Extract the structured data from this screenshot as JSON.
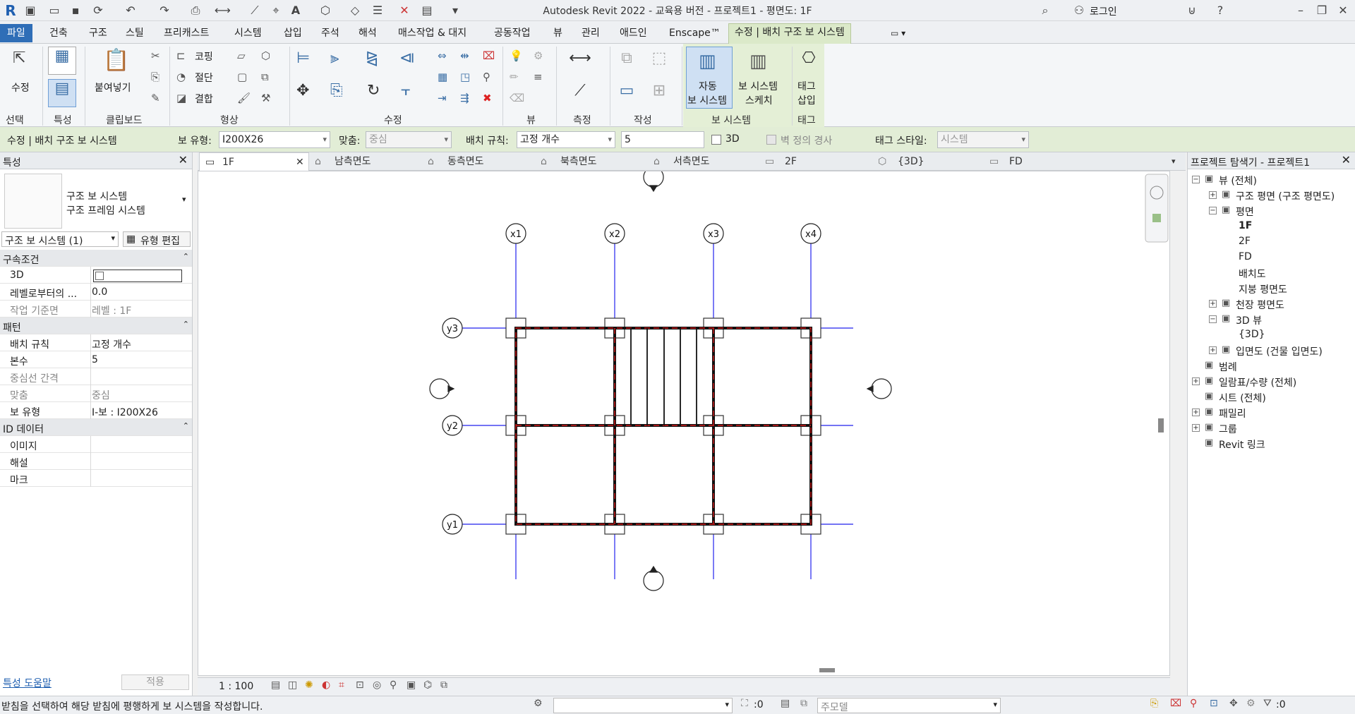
{
  "app": {
    "title": "Autodesk Revit 2022 - 교육용 버전 - 프로젝트1 - 평면도: 1F",
    "login": "로그인"
  },
  "menu": {
    "tabs": [
      "파일",
      "건축",
      "구조",
      "스틸",
      "프리캐스트",
      "시스템",
      "삽입",
      "주석",
      "해석",
      "매스작업 & 대지",
      "공동작업",
      "뷰",
      "관리",
      "애드인",
      "Enscape™"
    ],
    "context_tab": "수정 | 배치 구조 보 시스템"
  },
  "ribbon": {
    "modify_label": "수정",
    "select_label": "선택",
    "properties_label": "특성",
    "paste_label": "붙여넣기",
    "clipboard_label": "클립보드",
    "cope_label": "코핑",
    "cut_label": "절단",
    "join_label": "결합",
    "geometry_label": "형상",
    "modify_panel_label": "수정",
    "view_panel_label": "뷰",
    "measure_panel_label": "측정",
    "create_panel_label": "작성",
    "auto_beam_label_1": "자동",
    "auto_beam_label_2": "보 시스템",
    "sketch_label_1": "보 시스템",
    "sketch_label_2": "스케치",
    "tag_label_1": "태그",
    "tag_label_2": "삽입",
    "beam_system_panel": "보 시스템",
    "tag_panel": "태그"
  },
  "options": {
    "context": "수정 | 배치 구조 보 시스템",
    "beam_type_label": "보 유형:",
    "beam_type_value": "I200X26",
    "justify_label": "맞춤:",
    "justify_value": "중심",
    "layout_label": "배치 규칙:",
    "layout_value": "고정 개수",
    "count_value": "5",
    "three_d_label": "3D",
    "wall_slope_label": "벽 정의 경사",
    "tag_style_label": "태그 스타일:",
    "tag_style_value": "시스템"
  },
  "properties": {
    "header": "특성",
    "type_line1": "구조 보 시스템",
    "type_line2": "구조 프레임 시스템",
    "selector": "구조 보 시스템 (1)",
    "edit_type": "유형 편집",
    "sections": [
      {
        "title": "구속조건",
        "rows": [
          {
            "k": "3D",
            "v": "",
            "checkbox": true
          },
          {
            "k": "레벨로부터의 ...",
            "v": "0.0"
          },
          {
            "k": "작업 기준면",
            "v": "레벨 : 1F",
            "grey": true
          }
        ]
      },
      {
        "title": "패턴",
        "rows": [
          {
            "k": "배치 규칙",
            "v": "고정 개수"
          },
          {
            "k": "본수",
            "v": "5"
          },
          {
            "k": "중심선 간격",
            "v": "",
            "grey": true
          },
          {
            "k": "맞춤",
            "v": "중심",
            "grey": true
          },
          {
            "k": "보 유형",
            "v": "I-보 : I200X26"
          }
        ]
      },
      {
        "title": "ID 데이터",
        "rows": [
          {
            "k": "이미지",
            "v": ""
          },
          {
            "k": "해설",
            "v": ""
          },
          {
            "k": "마크",
            "v": ""
          }
        ]
      }
    ],
    "help_link": "특성 도움말",
    "apply": "적용"
  },
  "view_tabs": [
    {
      "label": "1F",
      "active": true
    },
    {
      "label": "남측면도"
    },
    {
      "label": "동측면도"
    },
    {
      "label": "북측면도"
    },
    {
      "label": "서측면도"
    },
    {
      "label": "2F"
    },
    {
      "label": "{3D}"
    },
    {
      "label": "FD"
    }
  ],
  "grid": {
    "x_labels": [
      "x1",
      "x2",
      "x3",
      "x4"
    ],
    "y_labels": [
      "y3",
      "y2",
      "y1"
    ]
  },
  "view_bar": {
    "scale": "1 : 100"
  },
  "browser": {
    "header": "프로젝트 탐색기 - 프로젝트1",
    "nodes": [
      {
        "label": "뷰 (전체)",
        "level": 0,
        "tog": "−"
      },
      {
        "label": "구조 평면 (구조 평면도)",
        "level": 1,
        "tog": "+"
      },
      {
        "label": "평면",
        "level": 1,
        "tog": "−"
      },
      {
        "label": "1F",
        "level": 2,
        "bold": true
      },
      {
        "label": "2F",
        "level": 2
      },
      {
        "label": "FD",
        "level": 2
      },
      {
        "label": "배치도",
        "level": 2
      },
      {
        "label": "지붕 평면도",
        "level": 2
      },
      {
        "label": "천장 평면도",
        "level": 1,
        "tog": "+"
      },
      {
        "label": "3D 뷰",
        "level": 1,
        "tog": "−"
      },
      {
        "label": "{3D}",
        "level": 2
      },
      {
        "label": "입면도 (건물 입면도)",
        "level": 1,
        "tog": "+"
      },
      {
        "label": "범례",
        "level": 0
      },
      {
        "label": "일람표/수량 (전체)",
        "level": 0,
        "tog": "+"
      },
      {
        "label": "시트 (전체)",
        "level": 0
      },
      {
        "label": "패밀리",
        "level": 0,
        "tog": "+"
      },
      {
        "label": "그룹",
        "level": 0,
        "tog": "+"
      },
      {
        "label": "Revit 링크",
        "level": 0
      }
    ]
  },
  "status": {
    "message": "받침을 선택하여 해당 받침에 평행하게 보 시스템을 작성합니다.",
    "worksets": ":0",
    "model": "주모델",
    "filter": ":0"
  },
  "colors": {
    "accent": "#2f6eb7",
    "context": "#e2edd6",
    "beam_red": "#d01818",
    "grid_blue": "#2222ee"
  }
}
